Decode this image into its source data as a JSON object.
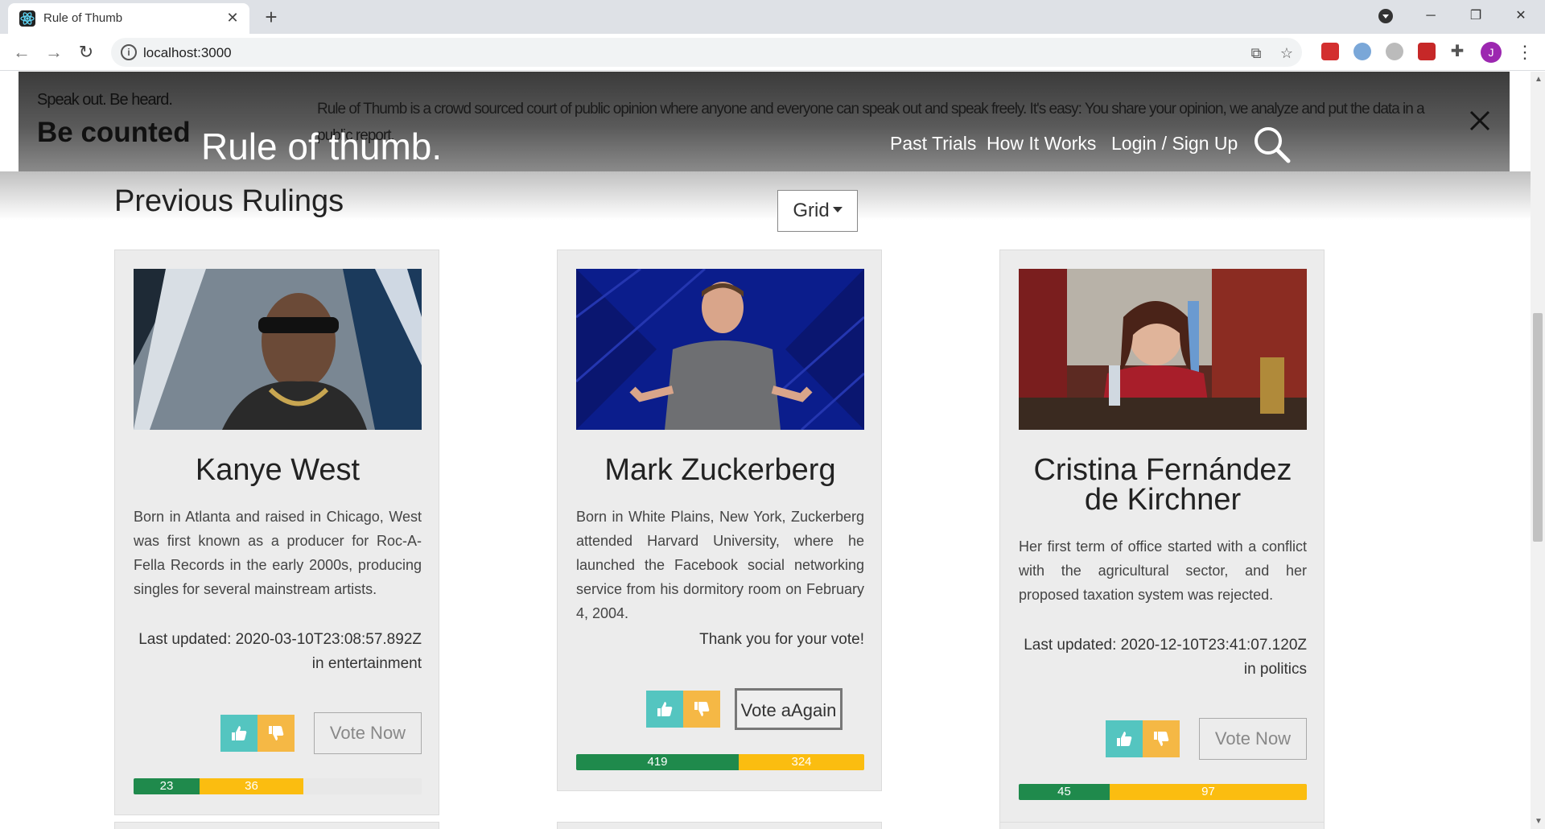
{
  "browser": {
    "tab_title": "Rule of Thumb",
    "url": "localhost:3000",
    "avatar_letter": "J"
  },
  "header": {
    "speak_out": "Speak out. Be heard.",
    "be_counted": "Be counted",
    "blurb": "Rule of Thumb is a crowd sourced court of public opinion where anyone and everyone can speak out and speak freely. It's easy: You share your opinion, we analyze and put the data in a public report.",
    "logo": "Rule of thumb.",
    "nav": [
      "Past Trials",
      "How It Works",
      "Login / Sign Up"
    ]
  },
  "main": {
    "title": "Previous Rulings",
    "view_select": "Grid"
  },
  "cards": [
    {
      "name": "Kanye West",
      "description": "Born in Atlanta and raised in Chicago, West was first known as a producer for Roc-A-Fella Records in the early 2000s, producing singles for several mainstream artists.",
      "meta": "Last updated: 2020-03-10T23:08:57.892Z in entertainment",
      "button": "Vote Now",
      "positive": 23,
      "negative": 36,
      "positive_label": "23",
      "negative_label": "36",
      "bar_fill_fraction": 0.59
    },
    {
      "name": "Mark Zuckerberg",
      "description": "Born in White Plains, New York, Zuckerberg attended Harvard University, where he launched the Facebook social networking service from his dormitory room on February 4, 2004.",
      "meta": "Thank you for your vote!",
      "button": "Vote aAgain",
      "positive": 419,
      "negative": 324,
      "positive_label": "419",
      "negative_label": "324",
      "bar_fill_fraction": 1.0
    },
    {
      "name": "Cristina Fernández de Kirchner",
      "description": "Her first term of office started with a conflict with the agricultural sector, and her proposed taxation system was rejected.",
      "meta": "Last updated: 2020-12-10T23:41:07.120Z in politics",
      "button": "Vote Now",
      "positive": 45,
      "negative": 97,
      "positive_label": "45",
      "negative_label": "97",
      "bar_fill_fraction": 1.0
    }
  ],
  "colors": {
    "thumb_up": "#54c5c0",
    "thumb_down": "#f5b845",
    "bar_positive": "#1f8a4c",
    "bar_negative": "#fbbd10"
  }
}
